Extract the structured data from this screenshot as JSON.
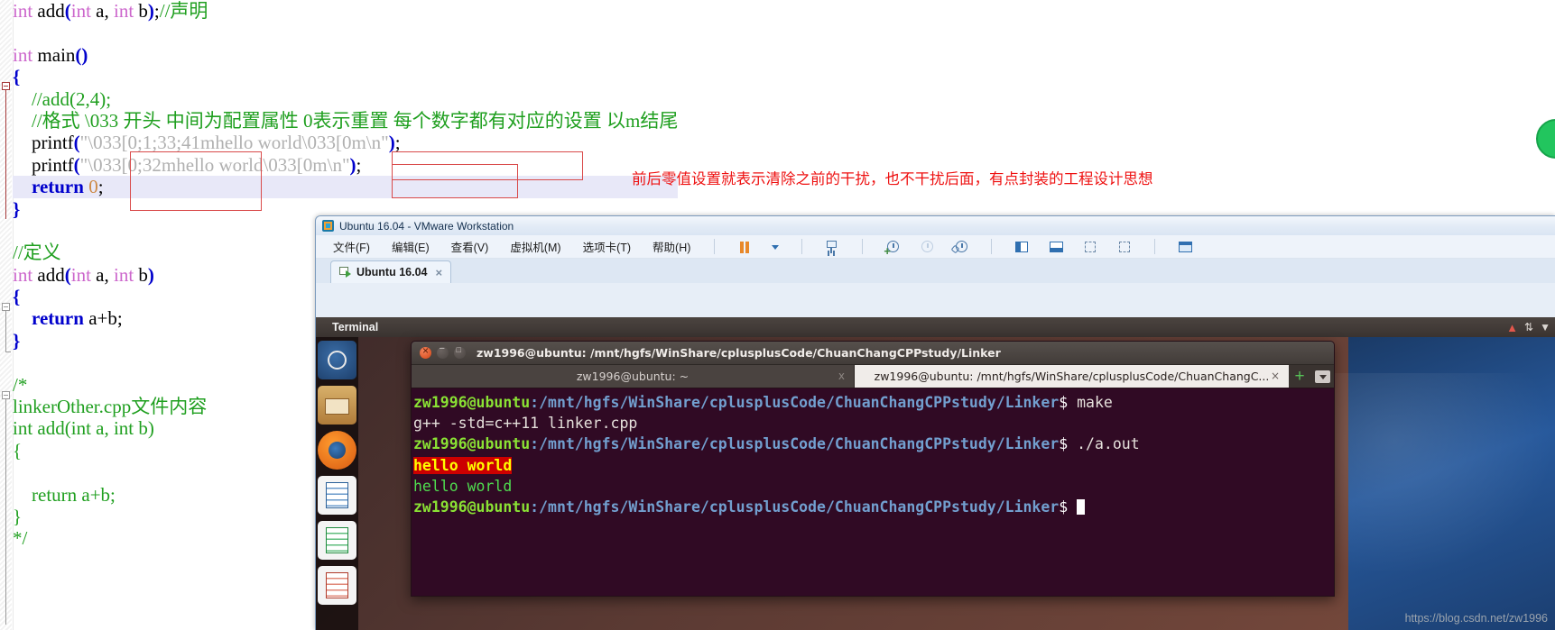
{
  "editor": {
    "lines": [
      [
        {
          "t": "int ",
          "c": "kw"
        },
        {
          "t": "add",
          "c": "txt"
        },
        {
          "t": "(",
          "c": "pn"
        },
        {
          "t": "int ",
          "c": "kw"
        },
        {
          "t": "a, ",
          "c": "txt"
        },
        {
          "t": "int ",
          "c": "kw"
        },
        {
          "t": "b",
          "c": "txt"
        },
        {
          "t": ")",
          "c": "pn"
        },
        {
          "t": ";",
          "c": "txt"
        },
        {
          "t": "//声明",
          "c": "cmt"
        }
      ],
      [],
      [
        {
          "t": "int ",
          "c": "kw"
        },
        {
          "t": "main",
          "c": "txt"
        },
        {
          "t": "()",
          "c": "pn"
        }
      ],
      [
        {
          "t": "{",
          "c": "pn"
        }
      ],
      [
        {
          "t": "    ",
          "c": "txt"
        },
        {
          "t": "//add(2,4);",
          "c": "cmt"
        }
      ],
      [
        {
          "t": "    ",
          "c": "txt"
        },
        {
          "t": "//格式 \\033 开头 中间为配置属性 0表示重置 每个数字都有对应的设置 以m结尾",
          "c": "cmt"
        }
      ],
      [
        {
          "t": "    printf",
          "c": "txt"
        },
        {
          "t": "(",
          "c": "pn"
        },
        {
          "t": "\"\\033[0;1;33;41mhello world\\033[0m\\n\"",
          "c": "str"
        },
        {
          "t": ")",
          "c": "pn"
        },
        {
          "t": ";",
          "c": "txt"
        }
      ],
      [
        {
          "t": "    printf",
          "c": "txt"
        },
        {
          "t": "(",
          "c": "pn"
        },
        {
          "t": "\"\\033[0;32mhello world\\033[0m\\n\"",
          "c": "str"
        },
        {
          "t": ")",
          "c": "pn"
        },
        {
          "t": ";",
          "c": "txt"
        }
      ],
      [
        {
          "t": "    ",
          "c": "txt"
        },
        {
          "t": "return ",
          "c": "kw2"
        },
        {
          "t": "0",
          "c": "num"
        },
        {
          "t": ";",
          "c": "txt"
        }
      ],
      [
        {
          "t": "}",
          "c": "pn"
        }
      ],
      [],
      [
        {
          "t": "//定义",
          "c": "cmt"
        }
      ],
      [
        {
          "t": "int ",
          "c": "kw"
        },
        {
          "t": "add",
          "c": "txt"
        },
        {
          "t": "(",
          "c": "pn"
        },
        {
          "t": "int ",
          "c": "kw"
        },
        {
          "t": "a, ",
          "c": "txt"
        },
        {
          "t": "int ",
          "c": "kw"
        },
        {
          "t": "b",
          "c": "txt"
        },
        {
          "t": ")",
          "c": "pn"
        }
      ],
      [
        {
          "t": "{",
          "c": "pn"
        }
      ],
      [
        {
          "t": "    ",
          "c": "txt"
        },
        {
          "t": "return ",
          "c": "kw2"
        },
        {
          "t": "a+b;",
          "c": "txt"
        }
      ],
      [
        {
          "t": "}",
          "c": "pn"
        }
      ],
      [],
      [
        {
          "t": "/*",
          "c": "cmt"
        }
      ],
      [
        {
          "t": "linkerOther.cpp文件内容",
          "c": "cmt"
        }
      ],
      [
        {
          "t": "int add(int a, int b)",
          "c": "cmt"
        }
      ],
      [
        {
          "t": "{",
          "c": "cmt"
        }
      ],
      [],
      [
        {
          "t": "    return a+b;",
          "c": "cmt"
        }
      ],
      [
        {
          "t": "}",
          "c": "cmt"
        }
      ],
      [
        {
          "t": "*/",
          "c": "cmt"
        }
      ]
    ],
    "highlighted_line_index": 8,
    "annotation_text": "前后零值设置就表示清除之前的干扰，也不干扰后面，有点封装的工程设计思想",
    "annotation_color": "#ee1111"
  },
  "vmware": {
    "title": "Ubuntu 16.04 - VMware Workstation",
    "menu": [
      "文件(F)",
      "编辑(E)",
      "查看(V)",
      "虚拟机(M)",
      "选项卡(T)",
      "帮助(H)"
    ],
    "toolbar_icons": [
      "pause-icon",
      "dropdown-caret-icon",
      "send-ctrl-alt-del-icon",
      "take-snapshot-icon",
      "revert-snapshot-icon",
      "manage-snapshots-icon",
      "show-sidebar-icon",
      "full-screen-icon",
      "stretch-guest-icon",
      "unity-mode-icon",
      "library-icon"
    ],
    "tab": {
      "label": "Ubuntu 16.04",
      "close_label": "×"
    }
  },
  "ubuntu": {
    "topbar_title": "Terminal",
    "launcher_items": [
      "ubuntu-dash-icon",
      "files-icon",
      "firefox-icon",
      "writer-icon",
      "calc-icon",
      "impress-icon"
    ],
    "indicator_icons": [
      "warning-indicator-icon",
      "network-indicator-icon",
      "volume-indicator-icon"
    ]
  },
  "terminal": {
    "window_title": "zw1996@ubuntu: /mnt/hgfs/WinShare/cplusplusCode/ChuanChangCPPstudy/Linker",
    "tabs": [
      {
        "label": "zw1996@ubuntu: ~",
        "active": false,
        "close": "x"
      },
      {
        "label": "zw1996@ubuntu: /mnt/hgfs/WinShare/cplusplusCode/ChuanChangC...",
        "active": true,
        "close": "×"
      }
    ],
    "new_tab_label": "+",
    "user": "zw1996@ubuntu",
    "path": ":/mnt/hgfs/WinShare/cplusplusCode/ChuanChangCPPstudy/Linker",
    "prompt_suffix": "$",
    "lines": [
      {
        "type": "prompt",
        "command": " make"
      },
      {
        "type": "output",
        "text": "g++ -std=c++11 linker.cpp",
        "style": "plain"
      },
      {
        "type": "prompt",
        "command": " ./a.out"
      },
      {
        "type": "output",
        "text": "hello world",
        "style": "yellow-on-red"
      },
      {
        "type": "output",
        "text": "hello world",
        "style": "green"
      },
      {
        "type": "prompt",
        "command": " ",
        "cursor": true
      }
    ]
  },
  "watermark": {
    "text": "https://blog.csdn.net/zw1996"
  },
  "colors": {
    "terminal_bg": "#300a24",
    "prompt_user": "#8ae234",
    "prompt_path": "#729fcf",
    "highlight_bg": "#cc0000",
    "highlight_fg": "#ffff00",
    "green_output": "#4fdd4f",
    "annotation_red": "#ee1111",
    "vm_chrome": "#e7eef7"
  }
}
